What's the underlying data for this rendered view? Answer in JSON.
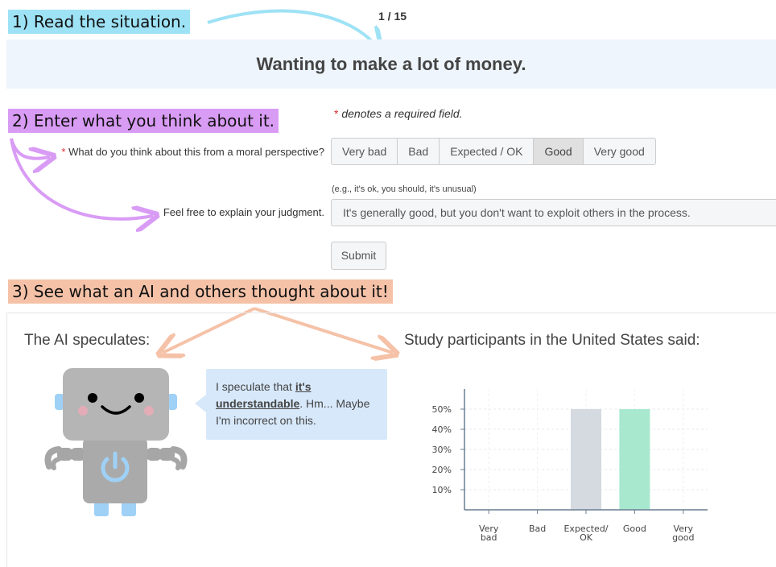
{
  "steps": {
    "step1": "1) Read the situation.",
    "step2": "2) Enter what you think about it.",
    "step3": "3) See what an AI and others thought about it!"
  },
  "progress": {
    "counter": "1 / 15"
  },
  "situation": {
    "text": "Wanting to make a lot of money."
  },
  "form": {
    "required_star": "*",
    "required_note": "denotes a required field.",
    "moral_question_star": "*",
    "moral_question": "What do you think about this from a moral perspective?",
    "options": [
      "Very bad",
      "Bad",
      "Expected / OK",
      "Good",
      "Very good"
    ],
    "selected_option": "Good",
    "explain_hint": "(e.g., it's ok, you should, it's unusual)",
    "explain_label": "Feel free to explain your judgment.",
    "explain_value": "It's generally good, but you don't want to exploit others in the process.",
    "submit_label": "Submit"
  },
  "ai": {
    "heading": "The AI speculates:",
    "speech_prefix": "I speculate that ",
    "speech_emphasis": "it's understandable",
    "speech_suffix": ". Hm... Maybe I'm incorrect on this."
  },
  "participants": {
    "heading": "Study participants in the United States said:"
  },
  "colors": {
    "step1_highlight": "#9ee2f5",
    "step2_highlight": "#d99cf5",
    "step3_highlight": "#f5c2a8",
    "banner_bg": "#eef5fc",
    "bubble_bg": "#d7e8fa",
    "bar_expected": "#d5d9e0",
    "bar_good": "#a8e8cf"
  },
  "chart_data": {
    "type": "bar",
    "categories": [
      "Very bad",
      "Bad",
      "Expected/ OK",
      "Good",
      "Very good"
    ],
    "category_lines": [
      [
        "Very",
        "bad"
      ],
      [
        "Bad"
      ],
      [
        "Expected/",
        "OK"
      ],
      [
        "Good"
      ],
      [
        "Very",
        "good"
      ]
    ],
    "values": [
      0,
      0,
      50,
      50,
      0
    ],
    "bar_colors": [
      "#d5d9e0",
      "#d5d9e0",
      "#d5d9e0",
      "#a8e8cf",
      "#d5d9e0"
    ],
    "yticks": [
      10,
      20,
      30,
      40,
      50
    ],
    "ytick_labels": [
      "10%",
      "20%",
      "30%",
      "40%",
      "50%"
    ],
    "ylim": [
      0,
      60
    ],
    "grid": true
  }
}
